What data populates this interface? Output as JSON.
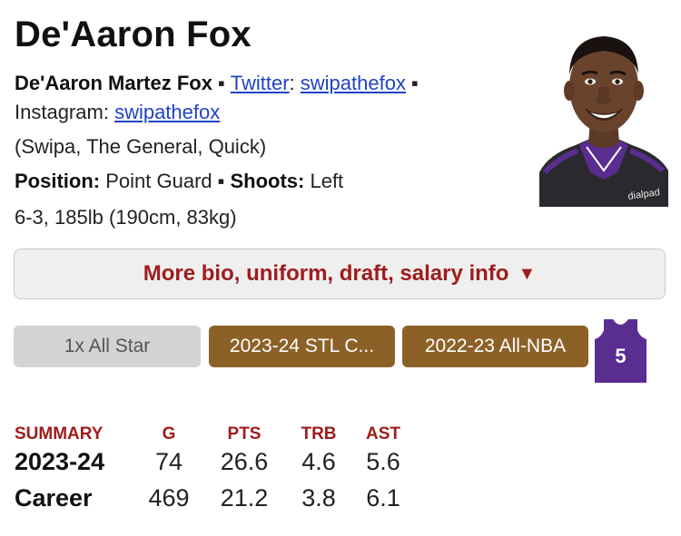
{
  "player": {
    "name": "De'Aaron Fox",
    "full_name": "De'Aaron Martez Fox",
    "separator": "▪",
    "twitter_label": "Twitter",
    "twitter_handle": "swipathefox",
    "instagram_label": "Instagram",
    "instagram_handle": "swipathefox",
    "nicknames": "(Swipa, The General, Quick)",
    "position_label": "Position:",
    "position": "Point Guard",
    "shoots_label": "Shoots:",
    "shoots": "Left",
    "size": "6-3, 185lb (190cm, 83kg)"
  },
  "more_info_button": {
    "label": "More bio, uniform, draft, salary info",
    "arrow": "▼"
  },
  "badges": [
    {
      "label": "1x All Star",
      "color": "#d3d3d3"
    },
    {
      "label": "2023-24 STL C...",
      "color": "#8c6128"
    },
    {
      "label": "2022-23 All-NBA",
      "color": "#8c6128"
    }
  ],
  "jersey": {
    "number": "5",
    "color": "#5a2d91"
  },
  "summary": {
    "headers": [
      "SUMMARY",
      "G",
      "PTS",
      "TRB",
      "AST"
    ],
    "rows": [
      {
        "label": "2023-24",
        "values": [
          "74",
          "26.6",
          "4.6",
          "5.6"
        ]
      },
      {
        "label": "Career",
        "values": [
          "469",
          "21.2",
          "3.8",
          "6.1"
        ]
      }
    ]
  },
  "colors": {
    "accent_red": "#a01c1c",
    "link_blue": "#1f43c6",
    "badge_gold": "#8c6128"
  },
  "icons": {
    "photo": "player-headshot",
    "jersey": "jersey-icon"
  }
}
